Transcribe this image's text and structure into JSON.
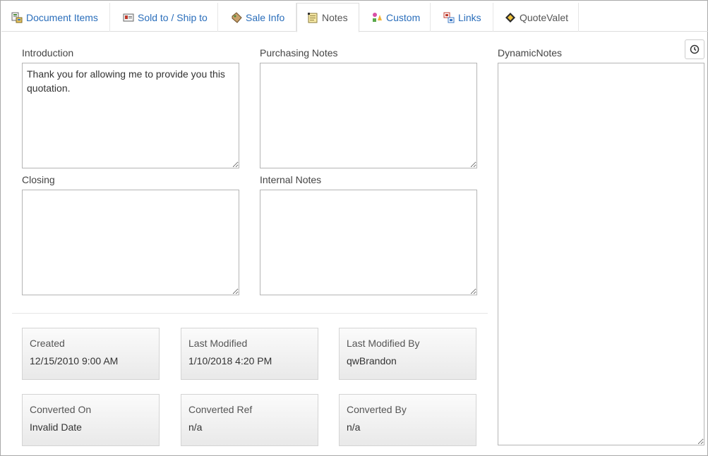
{
  "tabs": [
    {
      "label": "Document Items",
      "icon": "document-items-icon"
    },
    {
      "label": "Sold to / Ship to",
      "icon": "address-card-icon"
    },
    {
      "label": "Sale Info",
      "icon": "sale-tag-icon"
    },
    {
      "label": "Notes",
      "icon": "notes-icon"
    },
    {
      "label": "Custom",
      "icon": "custom-shapes-icon"
    },
    {
      "label": "Links",
      "icon": "links-icon"
    },
    {
      "label": "QuoteValet",
      "icon": "quotevalet-icon"
    }
  ],
  "fields": {
    "introduction": {
      "label": "Introduction",
      "value": "Thank you for allowing me to provide you this quotation."
    },
    "purchasing_notes": {
      "label": "Purchasing Notes",
      "value": ""
    },
    "closing": {
      "label": "Closing",
      "value": ""
    },
    "internal_notes": {
      "label": "Internal Notes",
      "value": ""
    },
    "dynamic_notes": {
      "label": "DynamicNotes",
      "value": ""
    }
  },
  "info": {
    "created": {
      "label": "Created",
      "value": "12/15/2010 9:00 AM"
    },
    "last_modified": {
      "label": "Last Modified",
      "value": "1/10/2018 4:20 PM"
    },
    "last_modified_by": {
      "label": "Last Modified By",
      "value": "qwBrandon"
    },
    "converted_on": {
      "label": "Converted On",
      "value": "Invalid Date"
    },
    "converted_ref": {
      "label": "Converted Ref",
      "value": "n/a"
    },
    "converted_by": {
      "label": "Converted By",
      "value": "n/a"
    }
  },
  "colors": {
    "link": "#2a6ebb",
    "border": "#b5b5b5",
    "info_bg": "#eeeeee"
  }
}
